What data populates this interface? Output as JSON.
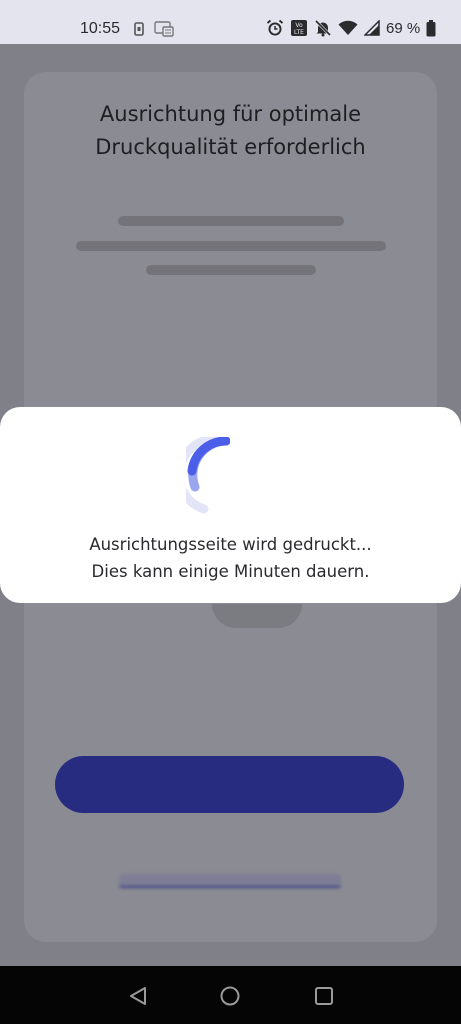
{
  "status_bar": {
    "time": "10:55",
    "battery_percent": "69 %",
    "left_icons": [
      "sim-card-icon",
      "screen-cast-icon"
    ],
    "right_icons": [
      "alarm-icon",
      "volte-icon",
      "notifications-muted-icon",
      "wifi-icon",
      "cell-signal-icon",
      "battery-icon"
    ]
  },
  "background_screen": {
    "title_line1": "Ausrichtung für optimale",
    "title_line2": "Druckqualität erforderlich"
  },
  "dialog": {
    "line1": "Ausrichtungsseite wird gedruckt...",
    "line2": "Dies kann einige Minuten dauern."
  },
  "colors": {
    "accent": "#4a5ee8",
    "primary_button": "#272c80",
    "dialog_bg": "#ffffff",
    "scrim": "#808088"
  },
  "nav_bar": {
    "buttons": [
      "back-icon",
      "home-icon",
      "recents-icon"
    ]
  }
}
